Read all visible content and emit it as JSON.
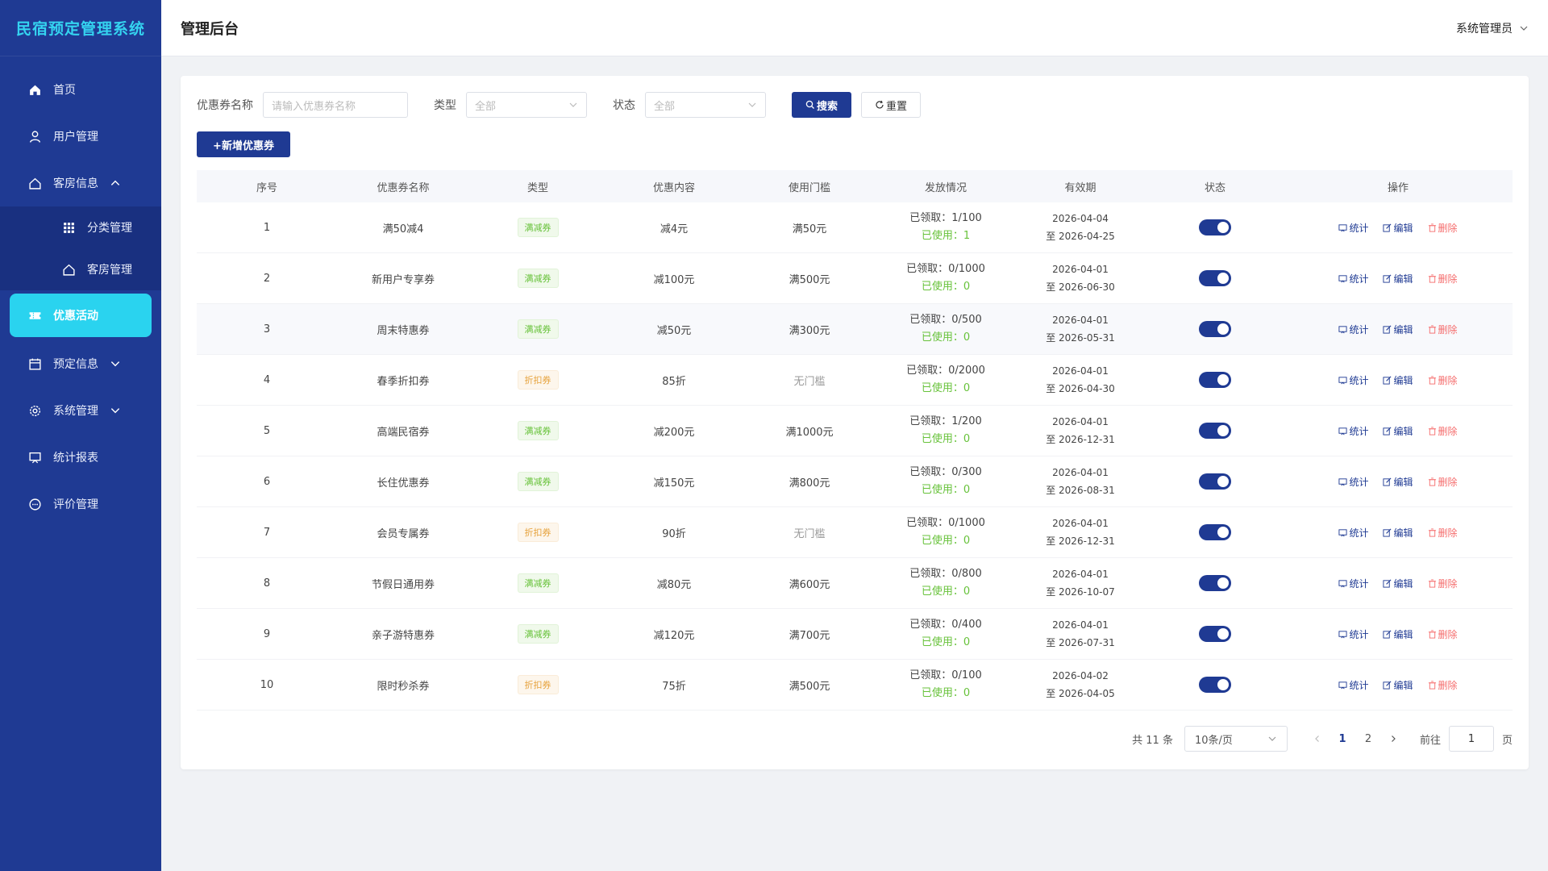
{
  "app": {
    "brand": "民宿预定管理系统"
  },
  "header": {
    "title": "管理后台",
    "user": "系统管理员"
  },
  "sidebar": {
    "items": [
      {
        "label": "首页",
        "icon": "home-icon"
      },
      {
        "label": "用户管理",
        "icon": "user-icon"
      },
      {
        "label": "客房信息",
        "icon": "house-icon",
        "expanded": true
      },
      {
        "label": "分类管理",
        "icon": "grid-icon",
        "sub": true
      },
      {
        "label": "客房管理",
        "icon": "house-icon",
        "sub": true
      },
      {
        "label": "优惠活动",
        "icon": "ticket-icon",
        "active": true
      },
      {
        "label": "预定信息",
        "icon": "calendar-icon"
      },
      {
        "label": "系统管理",
        "icon": "gear-icon"
      },
      {
        "label": "统计报表",
        "icon": "report-icon"
      },
      {
        "label": "评价管理",
        "icon": "comment-icon"
      }
    ]
  },
  "filter": {
    "name_label": "优惠券名称",
    "name_placeholder": "请输入优惠券名称",
    "type_label": "类型",
    "type_value": "全部",
    "status_label": "状态",
    "status_value": "全部",
    "search_label": "搜索",
    "reset_label": "重置"
  },
  "toolbar": {
    "add_label": "+新增优惠券"
  },
  "table": {
    "columns": [
      "序号",
      "优惠券名称",
      "类型",
      "优惠内容",
      "使用门槛",
      "发放情况",
      "有效期",
      "状态",
      "操作"
    ],
    "ops": {
      "stats": "统计",
      "edit": "编辑",
      "delete": "删除"
    },
    "rows": [
      {
        "no": "1",
        "name": "满50减4",
        "type": "满减券",
        "kind": "full",
        "content": "减4元",
        "threshold": "满50元",
        "received": "已领取：1/100",
        "used": "已使用：1",
        "start": "2026-04-04",
        "end": "至 2026-04-25",
        "enabled": true
      },
      {
        "no": "2",
        "name": "新用户专享券",
        "type": "满减券",
        "kind": "full",
        "content": "减100元",
        "threshold": "满500元",
        "received": "已领取：0/1000",
        "used": "已使用：0",
        "start": "2026-04-01",
        "end": "至 2026-06-30",
        "enabled": true
      },
      {
        "no": "3",
        "name": "周末特惠券",
        "type": "满减券",
        "kind": "full",
        "content": "减50元",
        "threshold": "满300元",
        "received": "已领取：0/500",
        "used": "已使用：0",
        "start": "2026-04-01",
        "end": "至 2026-05-31",
        "enabled": true
      },
      {
        "no": "4",
        "name": "春季折扣券",
        "type": "折扣券",
        "kind": "disc",
        "content": "85折",
        "threshold": "无门槛",
        "received": "已领取：0/2000",
        "used": "已使用：0",
        "start": "2026-04-01",
        "end": "至 2026-04-30",
        "enabled": true
      },
      {
        "no": "5",
        "name": "高端民宿券",
        "type": "满减券",
        "kind": "full",
        "content": "减200元",
        "threshold": "满1000元",
        "received": "已领取：1/200",
        "used": "已使用：0",
        "start": "2026-04-01",
        "end": "至 2026-12-31",
        "enabled": true
      },
      {
        "no": "6",
        "name": "长住优惠券",
        "type": "满减券",
        "kind": "full",
        "content": "减150元",
        "threshold": "满800元",
        "received": "已领取：0/300",
        "used": "已使用：0",
        "start": "2026-04-01",
        "end": "至 2026-08-31",
        "enabled": true
      },
      {
        "no": "7",
        "name": "会员专属券",
        "type": "折扣券",
        "kind": "disc",
        "content": "90折",
        "threshold": "无门槛",
        "received": "已领取：0/1000",
        "used": "已使用：0",
        "start": "2026-04-01",
        "end": "至 2026-12-31",
        "enabled": true
      },
      {
        "no": "8",
        "name": "节假日通用券",
        "type": "满减券",
        "kind": "full",
        "content": "减80元",
        "threshold": "满600元",
        "received": "已领取：0/800",
        "used": "已使用：0",
        "start": "2026-04-01",
        "end": "至 2026-10-07",
        "enabled": true
      },
      {
        "no": "9",
        "name": "亲子游特惠券",
        "type": "满减券",
        "kind": "full",
        "content": "减120元",
        "threshold": "满700元",
        "received": "已领取：0/400",
        "used": "已使用：0",
        "start": "2026-04-01",
        "end": "至 2026-07-31",
        "enabled": true
      },
      {
        "no": "10",
        "name": "限时秒杀券",
        "type": "折扣券",
        "kind": "disc",
        "content": "75折",
        "threshold": "满500元",
        "received": "已领取：0/100",
        "used": "已使用：0",
        "start": "2026-04-02",
        "end": "至 2026-04-05",
        "enabled": true
      }
    ]
  },
  "pagination": {
    "total": "共 11 条",
    "page_size": "10条/页",
    "pages": [
      "1",
      "2"
    ],
    "current": "1",
    "goto_label": "前往",
    "goto_value": "1",
    "page_suffix": "页"
  },
  "colors": {
    "primary": "#1f3a93",
    "active_menu": "#2ad3ef",
    "success": "#67c23a",
    "warning": "#e6a23c",
    "danger": "#f56c6c"
  }
}
